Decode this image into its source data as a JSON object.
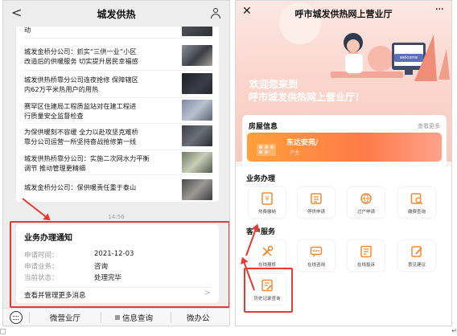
{
  "left": {
    "header": {
      "title": "城发供热"
    },
    "news": [
      {
        "lines": [
          "动"
        ]
      },
      {
        "lines": [
          "城发金桥分公司：抓实“三供一业”小区",
          "改造后的供暖服务 切实提升居民幸福感"
        ]
      },
      {
        "lines": [
          "城发供热桥靠分公司连夜抢修 保障辖区",
          "内62万平米热用户的用热"
        ]
      },
      {
        "lines": [
          "赛罕区住建局工程质监站对在建工程进",
          "行质量安全监督检查"
        ]
      },
      {
        "lines": [
          "为保供暖刻不容缓 全力以赴攻坚克难桥",
          "靠分公司运营一所坚持奋战抢修第一线"
        ]
      },
      {
        "lines": [
          "城发供热桥靠分公司：实施二次网水力平衡",
          "调节 推动管理更精细"
        ]
      },
      {
        "lines": [
          "城发金桥分公司：保供暖责任重于泰山"
        ]
      }
    ],
    "time": "14:56",
    "notice": {
      "title": "业务办理通知",
      "rows": [
        {
          "key": "申请时间：",
          "value": "2021-12-03"
        },
        {
          "key": "申请业务：",
          "value": "咨询"
        },
        {
          "key": "当前状态：",
          "value": "处理完毕"
        }
      ],
      "more": "查看并管理更多消息",
      "chevron": ">"
    },
    "bottom_tabs": [
      "微营业厅",
      "信息查询",
      "微办公"
    ]
  },
  "right": {
    "header": {
      "title": "呼市城发供热网上营业厅",
      "more": "···",
      "close": "✕"
    },
    "welcome_line1": "欢迎您来到",
    "welcome_line2": "呼市城发供热网上营业厅！",
    "hero_badge": "welcome",
    "house": {
      "title": "房屋信息",
      "more": "查看更多",
      "name": "东达安苑/",
      "sub": "户主："
    },
    "sections": [
      {
        "title": "业务办理",
        "items": [
          {
            "label": "热费缴纳",
            "icon": "fee-payment-icon"
          },
          {
            "label": "停供申请",
            "icon": "stop-supply-icon"
          },
          {
            "label": "过户申请",
            "icon": "transfer-icon"
          },
          {
            "label": "缴费查询",
            "icon": "payment-query-icon"
          }
        ]
      },
      {
        "title": "客户服务",
        "items": [
          {
            "label": "在线报修",
            "icon": "repair-icon"
          },
          {
            "label": "在线咨询",
            "icon": "consult-icon"
          },
          {
            "label": "在线投诉",
            "icon": "complaint-icon"
          },
          {
            "label": "意见建议",
            "icon": "suggestion-icon"
          },
          {
            "label": "历史记录查询",
            "icon": "history-icon"
          }
        ]
      }
    ]
  },
  "colors": {
    "accent_red": "#e53b33",
    "tile_orange": "#f08a35",
    "hero_pink": "#fbd7cf",
    "banner_orange": "#ff8a3d"
  }
}
